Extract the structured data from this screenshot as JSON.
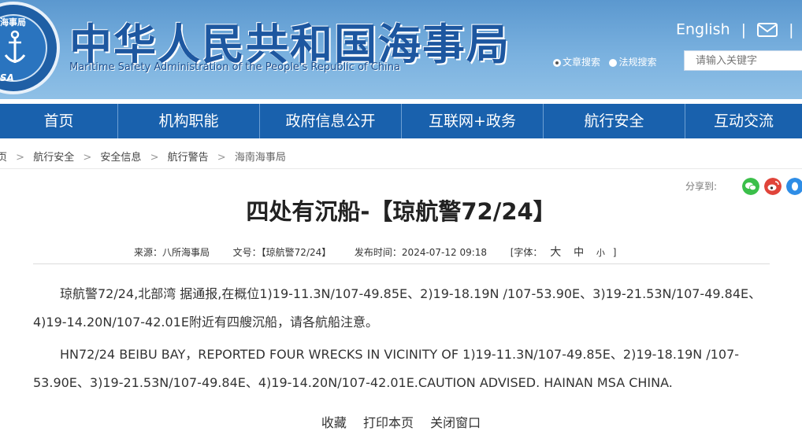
{
  "header": {
    "logo_top_text": "海事局",
    "logo_bottom_text": "INA MSA",
    "title_cn": "中华人民共和国海事局",
    "title_en": "Maritime Safety Administration of the People's Republic of China",
    "lang_link": "English",
    "sep1": "|",
    "sep2": "|",
    "search_option_1": "文章搜索",
    "search_option_2": "法规搜索",
    "search_placeholder": "请输入关键字"
  },
  "nav": [
    "首页",
    "机构职能",
    "政府信息公开",
    "互联网+政务",
    "航行安全",
    "互动交流"
  ],
  "breadcrumb": {
    "items": [
      "页",
      "航行安全",
      "安全信息",
      "航行警告",
      "海南海事局"
    ],
    "arrow": ">"
  },
  "share": {
    "label": "分享到:"
  },
  "article": {
    "title": "四处有沉船-【琼航警72/24】",
    "meta": {
      "source": "来源：八所海事局",
      "doc_no": "文号：【琼航警72/24】",
      "date": "发布时间：2024-07-12 09:18",
      "font_label": "[字体：",
      "font_large": "大",
      "font_medium": "中",
      "font_small": "小",
      "font_close": "]"
    },
    "para_cn": "琼航警72/24,北部湾 据通报,在概位1)19-11.3N/107-49.85E、2)19-18.19N /107-53.90E、3)19-21.53N/107-49.84E、4)19-14.20N/107-42.01E附近有四艘沉船，请各航船注意。",
    "para_en": "HN72/24 BEIBU BAY，REPORTED FOUR  WRECKS IN VICINITY OF 1)19-11.3N/107-49.85E、2)19-18.19N /107-53.90E、3)19-21.53N/107-49.84E、4)19-14.20N/107-42.01E.CAUTION ADVISED. HAINAN MSA CHINA."
  },
  "actions": {
    "favorite": "收藏",
    "print": "打印本页",
    "close": "关闭窗口"
  },
  "colors": {
    "brand_blue": "#1961ad",
    "title_blue": "#1d57a0",
    "wechat": "#3bbf4a",
    "weibo": "#e0443a",
    "qq": "#2e8de6"
  },
  "icons": [
    "anchor-icon",
    "mail-icon",
    "wechat-icon",
    "weibo-icon",
    "qq-icon"
  ]
}
